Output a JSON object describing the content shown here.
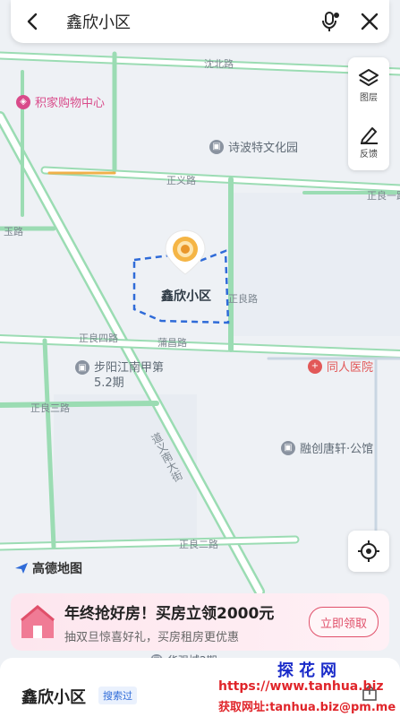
{
  "search": {
    "query": "鑫欣小区"
  },
  "side_panel": {
    "layers_label": "图层",
    "feedback_label": "反馈"
  },
  "map": {
    "pois": [
      {
        "id": "mall",
        "name": "积家购物中心",
        "color": "#d94b8a"
      },
      {
        "id": "culture",
        "name": "诗波特文化园",
        "color": "#8a93a0"
      },
      {
        "id": "hospital",
        "name": "同人医院",
        "color": "#e25858"
      },
      {
        "id": "estate",
        "name": "融创唐轩·公馆",
        "color": "#8a93a0"
      },
      {
        "id": "bywater",
        "name": "步阳江南甲第5.2期",
        "color": "#8a93a0"
      },
      {
        "id": "huaqiang",
        "name": "华强城2期",
        "color": "#8a93a0"
      }
    ],
    "roads": {
      "r1": "沈北路",
      "r2": "正义路",
      "r3": "正良四路",
      "r4": "蒲昌路",
      "r5": "正良二路",
      "r6": "正良三路",
      "r7": "道义南大街",
      "r8": "正良路",
      "r9": "正良一路",
      "r10": "玉路"
    },
    "selected_community": "鑫欣小区",
    "brand": "高德地图"
  },
  "banner": {
    "headline": "年终抢好房！买房立领2000元",
    "subtext": "抽双旦惊喜好礼，买房租房更优惠",
    "cta": "立即领取"
  },
  "sheet": {
    "place_name": "鑫欣小区",
    "tag": "搜索过"
  },
  "watermark": {
    "title": "探花网",
    "url": "https://www.tanhua.biz",
    "mail": "获取网址:tanhua.biz@pm.me"
  },
  "colors": {
    "road_green": "#8bd9a6",
    "boundary_blue": "#2f6bd8",
    "accent_pink": "#e0506a"
  }
}
